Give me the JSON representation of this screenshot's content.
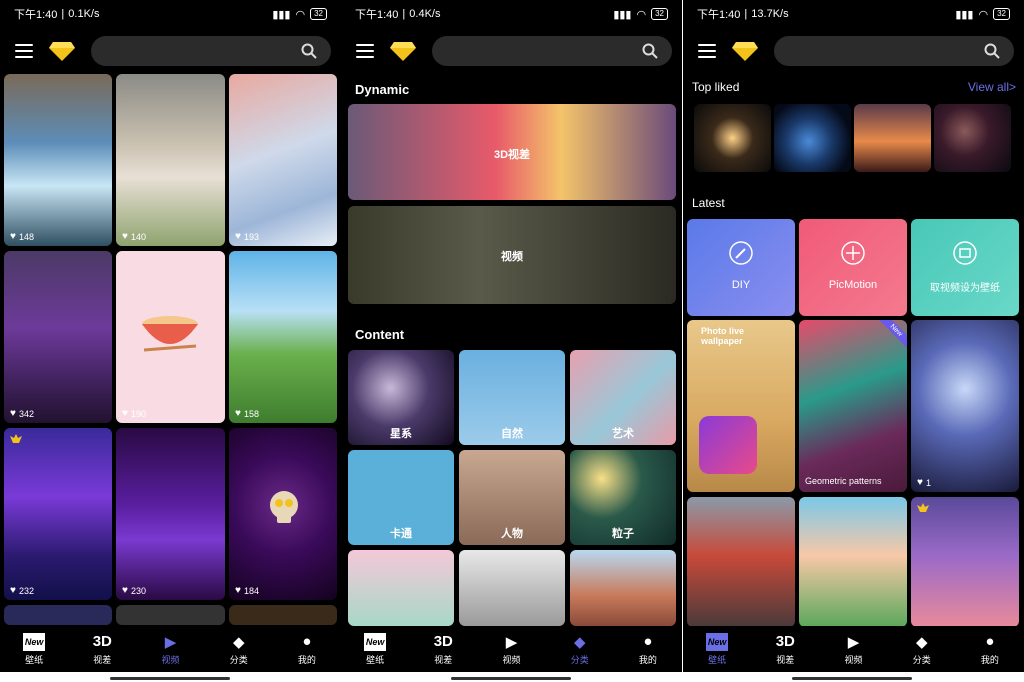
{
  "status": {
    "time": "下午1:40",
    "speed1": "0.1K/s",
    "speed2": "0.4K/s",
    "speed3": "13.7K/s",
    "battery": "32"
  },
  "icons": {
    "menu": "menu-icon",
    "gem": "diamond-icon",
    "search": "search-icon",
    "heart": "heart-icon"
  },
  "screen1": {
    "likes": [
      "148",
      "140",
      "193",
      "342",
      "190",
      "158",
      "232",
      "230",
      "184"
    ]
  },
  "screen2": {
    "dynamic_title": "Dynamic",
    "dynamic_items": [
      "3D视差",
      "视频"
    ],
    "content_title": "Content",
    "content_items": [
      "星系",
      "自然",
      "艺术",
      "卡通",
      "人物",
      "粒子"
    ]
  },
  "screen3": {
    "top_liked": "Top liked",
    "view_all": "View all>",
    "latest": "Latest",
    "feature_cards": [
      "DIY",
      "PicMotion",
      "取视频设为壁纸"
    ],
    "photo_live": "Photo live wallpaper",
    "geo": "Geometric patterns",
    "new_badge": "New",
    "likes": "1"
  },
  "nav": [
    "壁纸",
    "视差",
    "视频",
    "分类",
    "我的"
  ],
  "nav_icons": [
    "New",
    "3D",
    "▶",
    "◆",
    "●"
  ],
  "colors": {
    "accent": "#6b6fe6",
    "gem": "#f3c21b",
    "bg": "#000000"
  }
}
